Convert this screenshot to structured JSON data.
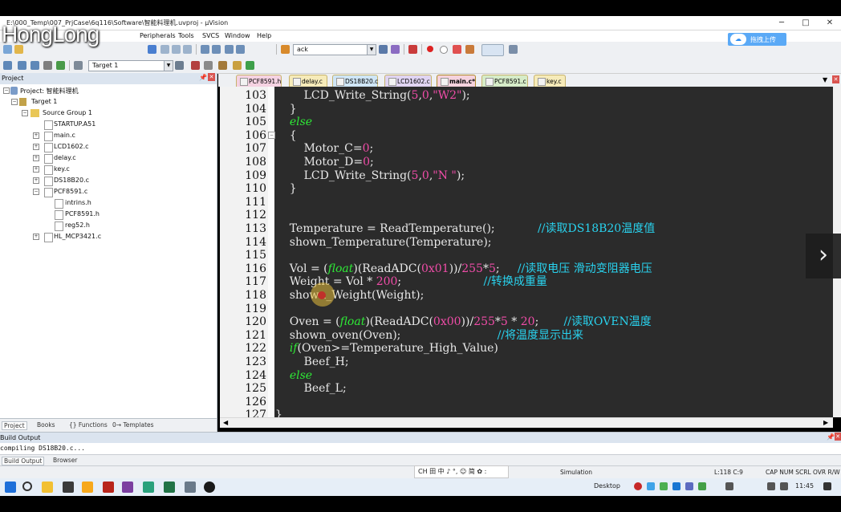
{
  "window": {
    "title": "E:\\000_Temp\\007_PrjCase\\6q116\\Software\\智能料理机.uvproj - µVision",
    "watermark": "HongLong",
    "upload_button": "拖拽上传",
    "controls": [
      "─",
      "□",
      "✕"
    ]
  },
  "menu": [
    "Peripherals",
    "Tools",
    "SVCS",
    "Window",
    "Help"
  ],
  "toolbar": {
    "find_value": "ack",
    "target": "Target 1"
  },
  "project": {
    "panel_title": "Project",
    "root": "Project: 智能料理机",
    "target": "Target 1",
    "group": "Source Group 1",
    "files": [
      {
        "name": "STARTUP.A51",
        "expander": ""
      },
      {
        "name": "main.c",
        "expander": "+"
      },
      {
        "name": "LCD1602.c",
        "expander": "+"
      },
      {
        "name": "delay.c",
        "expander": "+"
      },
      {
        "name": "key.c",
        "expander": "+"
      },
      {
        "name": "DS18B20.c",
        "expander": "+"
      },
      {
        "name": "PCF8591.c",
        "expander": "−"
      }
    ],
    "subfiles": [
      "intrins.h",
      "PCF8591.h",
      "reg52.h"
    ],
    "last_file": "HL_MCP3421.c",
    "tabs": [
      "Project",
      "Books",
      "{} Functions",
      "0→ Templates"
    ]
  },
  "file_tabs": [
    {
      "label": "PCF8591.h",
      "color": "#f5d2e2",
      "active": false
    },
    {
      "label": "delay.c",
      "color": "#f6ebb9",
      "active": false
    },
    {
      "label": "DS18B20.c",
      "color": "#cfe6f6",
      "active": false
    },
    {
      "label": "LCD1602.c",
      "color": "#e0d4f2",
      "active": false
    },
    {
      "label": "main.c*",
      "color": "#f5d2dd",
      "active": true
    },
    {
      "label": "PCF8591.c",
      "color": "#d6ecc8",
      "active": false
    },
    {
      "label": "key.c",
      "color": "#f6ebb9",
      "active": false
    }
  ],
  "code_lines": [
    {
      "n": "103",
      "html": "        LCD_Write_String(<span class=\"num\">5</span>,<span class=\"num\">0</span>,<span class=\"str\">\"W2\"</span>);"
    },
    {
      "n": "104",
      "html": "    }"
    },
    {
      "n": "105",
      "html": "    <span class=\"kw\">else</span>"
    },
    {
      "n": "106",
      "html": "    {"
    },
    {
      "n": "107",
      "html": "        Motor_C=<span class=\"num\">0</span>;"
    },
    {
      "n": "108",
      "html": "        Motor_D=<span class=\"num\">0</span>;"
    },
    {
      "n": "109",
      "html": "        LCD_Write_String(<span class=\"num\">5</span>,<span class=\"num\">0</span>,<span class=\"str\">\"N \"</span>);"
    },
    {
      "n": "110",
      "html": "    }"
    },
    {
      "n": "111",
      "html": ""
    },
    {
      "n": "112",
      "html": ""
    },
    {
      "n": "113",
      "html": "    Temperature = ReadTemperature();            <span class=\"cmt\">//读取DS18B20温度值</span>"
    },
    {
      "n": "114",
      "html": "    shown_Temperature(Temperature);"
    },
    {
      "n": "115",
      "html": ""
    },
    {
      "n": "116",
      "html": "    Vol = (<span class=\"kw\">float</span>)(ReadADC(<span class=\"num\">0x01</span>))/<span class=\"num\">255</span>*<span class=\"num\">5</span>;     <span class=\"cmt\">//读取电压 滑动变阻器电压</span>"
    },
    {
      "n": "117",
      "html": "    Weight = Vol * <span class=\"num\">200</span>;                       <span class=\"cmt\">//转换成重量</span>"
    },
    {
      "n": "118",
      "html": "    shown_Weight(Weight);"
    },
    {
      "n": "119",
      "html": ""
    },
    {
      "n": "120",
      "html": "    Oven = (<span class=\"kw\">float</span>)(ReadADC(<span class=\"num\">0x00</span>))/<span class=\"num\">255</span>*<span class=\"num\">5</span> * <span class=\"num\">20</span>;       <span class=\"cmt\">//读取OVEN温度</span>"
    },
    {
      "n": "121",
      "html": "    shown_oven(Oven);                           <span class=\"cmt\">//将温度显示出来</span>"
    },
    {
      "n": "122",
      "html": "    <span class=\"kw\">if</span>(Oven&gt;=Temperature_High_Value)"
    },
    {
      "n": "123",
      "html": "        Beef_H;"
    },
    {
      "n": "124",
      "html": "    <span class=\"kw\">else</span>"
    },
    {
      "n": "125",
      "html": "        Beef_L;"
    },
    {
      "n": "126",
      "html": ""
    },
    {
      "n": "127",
      "html": "}"
    }
  ],
  "build": {
    "title": "Build Output",
    "text": "compiling DS18B20.c...",
    "tabs": [
      "Build Output",
      "Browser"
    ]
  },
  "status": {
    "ime": "CH 田 中 ♪ °, ☺ 简 ✿ :",
    "mode": "Simulation",
    "cursor": "L:118 C:9",
    "flags": "CAP  NUM  SCRL  OVR  R/W"
  },
  "taskbar": {
    "desktop": "Desktop",
    "time": "11:45"
  }
}
